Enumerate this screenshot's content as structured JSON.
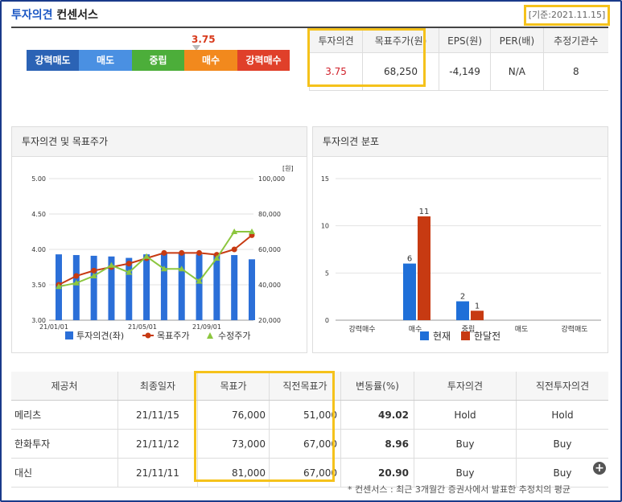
{
  "header": {
    "title_a": "투자의견",
    "title_b": "컨센서스",
    "date": "[기준:2021.11.15]"
  },
  "scale": {
    "marker": "3.75",
    "items": [
      {
        "label": "강력매도",
        "color": "#2b63b5"
      },
      {
        "label": "매도",
        "color": "#4a90e2"
      },
      {
        "label": "중립",
        "color": "#4cae3a"
      },
      {
        "label": "매수",
        "color": "#f2891d"
      },
      {
        "label": "강력매수",
        "color": "#e0402a"
      }
    ]
  },
  "summary": {
    "headers": [
      "투자의견",
      "목표주가(원)",
      "EPS(원)",
      "PER(배)",
      "추정기관수"
    ],
    "values": [
      "3.75",
      "68,250",
      "-4,149",
      "N/A",
      "8"
    ]
  },
  "left_panel": {
    "title": "투자의견 및 목표주가",
    "unit": "[원]",
    "legend": [
      "투자의견(좌)",
      "목표주가",
      "수정주가"
    ]
  },
  "right_panel": {
    "title": "투자의견 분포",
    "legend": [
      "현재",
      "한달전"
    ]
  },
  "chart_data": [
    {
      "type": "bar+line",
      "title": "투자의견 및 목표주가",
      "x_ticks": [
        "21/01/01",
        "21/05/01",
        "21/09/01"
      ],
      "ylim_left": [
        3.0,
        5.0
      ],
      "yticks_left": [
        "5.00",
        "4.50",
        "4.00",
        "3.50",
        "3.00"
      ],
      "ylim_right": [
        20000,
        100000
      ],
      "yticks_right": [
        "100,000",
        "80,000",
        "60,000",
        "40,000",
        "20,000"
      ],
      "series": [
        {
          "name": "투자의견(좌)",
          "values": [
            3.93,
            3.92,
            3.91,
            3.9,
            3.88,
            3.93,
            3.94,
            3.95,
            3.93,
            3.93,
            3.92,
            3.86
          ]
        },
        {
          "name": "목표주가",
          "values": [
            40000,
            45000,
            48000,
            50000,
            52000,
            55000,
            58000,
            58000,
            58000,
            57000,
            60000,
            68000
          ]
        },
        {
          "name": "수정주가",
          "values": [
            39000,
            41000,
            45000,
            51000,
            47000,
            56000,
            49000,
            49000,
            42000,
            55000,
            70000,
            70000
          ]
        }
      ]
    },
    {
      "type": "bar",
      "title": "투자의견 분포",
      "categories": [
        "강력매수",
        "매수",
        "중립",
        "매도",
        "강력매도"
      ],
      "ylim": [
        0,
        15
      ],
      "yticks": [
        "15",
        "10",
        "5",
        "0"
      ],
      "series": [
        {
          "name": "현재",
          "values": [
            0,
            6,
            2,
            0,
            0
          ]
        },
        {
          "name": "한달전",
          "values": [
            0,
            11,
            1,
            0,
            0
          ]
        }
      ]
    }
  ],
  "detail": {
    "headers": [
      "제공처",
      "최종일자",
      "목표가",
      "직전목표가",
      "변동률(%)",
      "투자의견",
      "직전투자의견"
    ],
    "rows": [
      [
        "메리츠",
        "21/11/15",
        "76,000",
        "51,000",
        "49.02",
        "Hold",
        "Hold"
      ],
      [
        "한화투자",
        "21/11/12",
        "73,000",
        "67,000",
        "8.96",
        "Buy",
        "Buy"
      ],
      [
        "대신",
        "21/11/11",
        "81,000",
        "67,000",
        "20.90",
        "Buy",
        "Buy"
      ]
    ]
  },
  "footnote": "* 컨센서스 : 최근 3개월간 증권사에서 발표한 추정치의 평균",
  "colors": {
    "accent": "#f5c21b",
    "blue": "#1f6fd8",
    "red": "#c73a12",
    "green": "#8cc63f"
  }
}
